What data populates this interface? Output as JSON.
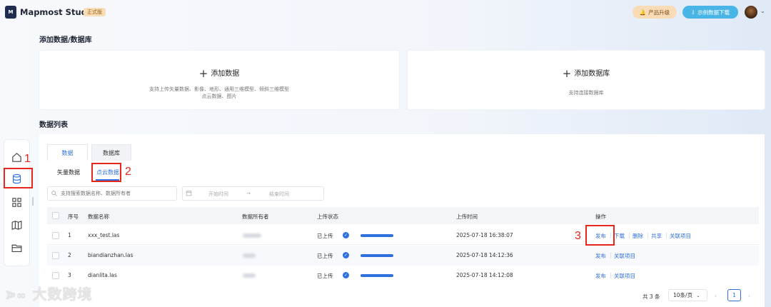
{
  "app": {
    "logo_text": "M",
    "name": "Mapmost Studio",
    "edition": "正式版"
  },
  "header": {
    "upgrade_label": "产品升级",
    "sample_download_label": "示例数据下载"
  },
  "add_section": {
    "title": "添加数据/数据库",
    "add_data": {
      "label": "添加数据",
      "desc_line1": "支持上传矢量数据、影像、地形、通用三维模型、倾斜三维模型",
      "desc_line2": "点云数据、图片"
    },
    "add_database": {
      "label": "添加数据库",
      "desc": "支持连接数据库"
    }
  },
  "list_section": {
    "title": "数据列表",
    "tabs": [
      "数据",
      "数据库"
    ],
    "subtabs": [
      "矢量数据",
      "点云数据"
    ],
    "search_placeholder": "支持搜索数据名称、数据所有者",
    "start_time_placeholder": "开始时间",
    "range_arrow": "→",
    "end_time_placeholder": "结束时间",
    "columns": [
      "序号",
      "数据名称",
      "数据所有者",
      "上传状态",
      "上传时间",
      "操作"
    ],
    "rows": [
      {
        "index": "1",
        "name": "xxx_test.las",
        "status": "已上传",
        "progress": 1.0,
        "time": "2025-07-18 16:38:07",
        "actions": [
          "发布",
          "下载",
          "删除",
          "共享",
          "关联项目"
        ]
      },
      {
        "index": "2",
        "name": "biandianzhan.las",
        "status": "已上传",
        "progress": 1.0,
        "time": "2025-07-18 14:12:36",
        "actions": [
          "发布",
          "关联项目"
        ]
      },
      {
        "index": "3",
        "name": "dianlita.las",
        "status": "已上传",
        "progress": 1.0,
        "time": "2025-07-18 14:12:08",
        "actions": [
          "发布",
          "关联项目"
        ]
      }
    ]
  },
  "pagination": {
    "total": "共 3 条",
    "page_size": "10条/页",
    "prev": "‹",
    "next": "›",
    "current": "1"
  },
  "annotations": [
    "1",
    "2",
    "3"
  ],
  "watermark": "大数跨境",
  "colors": {
    "accent": "#2f6fe0",
    "annotation": "#e5271d",
    "badge_bg": "#f9ddb6",
    "sample_btn": "#49b5e7"
  }
}
